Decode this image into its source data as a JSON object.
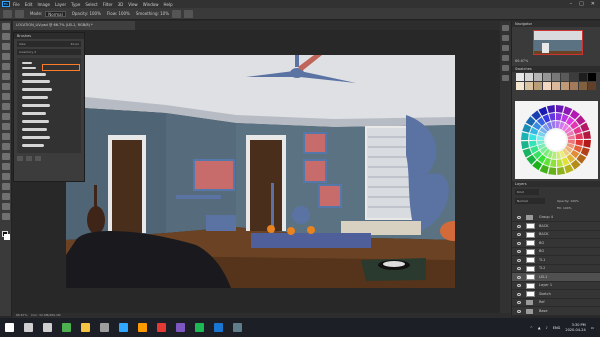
{
  "menubar": {
    "app_icon": "Ps",
    "items": [
      "File",
      "Edit",
      "Image",
      "Layer",
      "Type",
      "Select",
      "Filter",
      "3D",
      "View",
      "Window",
      "Help"
    ]
  },
  "optionsbar": {
    "mode": "Mode:",
    "mode_value": "Normal",
    "opacity": "Opacity: 100%",
    "flow": "Flow: 100%",
    "smoothing": "Smoothing: 10%"
  },
  "document": {
    "tab_title": "LOCATION_LIV.psd @ 66.7% (LEL1, RGB/8) *",
    "status_zoom": "66.67%",
    "status_doc": "Doc: 32.9M/269.1M"
  },
  "brush_panel": {
    "title": "Brushes",
    "size_label": "Size:",
    "size_value": "40 px",
    "folder": "Inventory 2"
  },
  "navigator": {
    "title": "Navigator",
    "zoom": "66.67%"
  },
  "swatches": {
    "title": "Swatches",
    "colors": [
      "#e8e8e8",
      "#d4d4d4",
      "#b4b4b4",
      "#969696",
      "#787878",
      "#5a5a5a",
      "#3c3c3c",
      "#1e1e1e",
      "#000000",
      "#f5e6d0",
      "#d9c2a0",
      "#b89d78",
      "#f2d8c2",
      "#dcb89a",
      "#c09a78",
      "#a07a5a",
      "#80603e",
      "#604028"
    ]
  },
  "layers": {
    "title": "Layers",
    "kind": "Kind",
    "blend": "Normal",
    "opacity": "Opacity: 100%",
    "fill": "Fill: 100%",
    "rows": [
      {
        "name": "Group 4",
        "type": "folder",
        "active": false
      },
      {
        "name": "BACK",
        "type": "thumb",
        "active": false
      },
      {
        "name": "BACK",
        "type": "thumb",
        "active": false
      },
      {
        "name": "BG",
        "type": "thumb",
        "active": false
      },
      {
        "name": "BG",
        "type": "thumb",
        "active": false
      },
      {
        "name": "TL1",
        "type": "thumb",
        "active": false
      },
      {
        "name": "TL2",
        "type": "thumb",
        "active": false
      },
      {
        "name": "LEL1",
        "type": "thumb",
        "active": true
      },
      {
        "name": "Layer 1",
        "type": "thumb",
        "active": false
      },
      {
        "name": "Sketch",
        "type": "thumb",
        "active": false
      },
      {
        "name": "Ref",
        "type": "folder",
        "active": false
      },
      {
        "name": "Base",
        "type": "folder",
        "active": false
      }
    ]
  },
  "taskbar": {
    "time": "3:30 PM",
    "date": "2020-04-24",
    "lang": "ENG",
    "apps": [
      {
        "name": "start-icon",
        "color": "#ffffff"
      },
      {
        "name": "search-icon",
        "color": "#cfcfcf"
      },
      {
        "name": "taskview-icon",
        "color": "#cfcfcf"
      },
      {
        "name": "browser-icon",
        "color": "#4caf50"
      },
      {
        "name": "explorer-icon",
        "color": "#f4c542"
      },
      {
        "name": "settings-icon",
        "color": "#9e9e9e"
      },
      {
        "name": "photoshop-icon",
        "color": "#31a8ff"
      },
      {
        "name": "illustrator-icon",
        "color": "#ff9a00"
      },
      {
        "name": "media-icon",
        "color": "#e53935"
      },
      {
        "name": "chat-icon",
        "color": "#7e57c2"
      },
      {
        "name": "music-icon",
        "color": "#1db954"
      },
      {
        "name": "mail-icon",
        "color": "#1976d2"
      },
      {
        "name": "game-icon",
        "color": "#607d8b"
      }
    ]
  }
}
